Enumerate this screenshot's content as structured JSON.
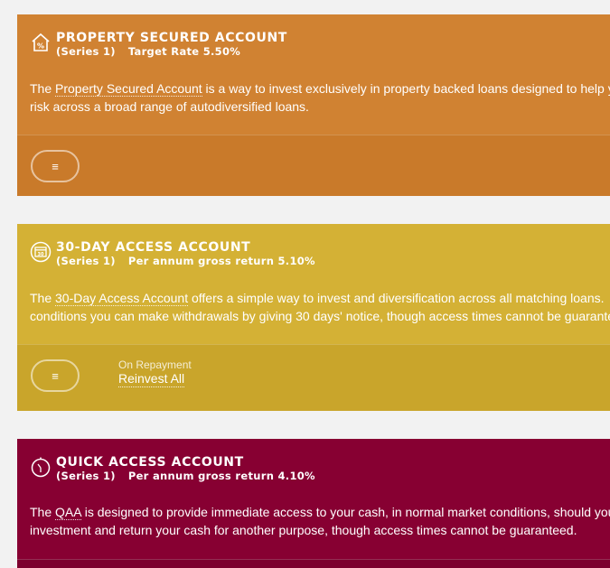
{
  "cards": [
    {
      "title": "PROPERTY SECURED ACCOUNT",
      "series": "(Series 1)",
      "rate_text": "Target Rate 5.50%",
      "desc_pre": "The ",
      "desc_link": "Property Secured Account",
      "desc_line1_post": " is a way to invest exclusively in property backed loans designed to help y",
      "desc_line2": "risk across a broad range of autodiversified loans.",
      "menu_glyph": "≡",
      "icon": "house-percent-icon",
      "color_top": "#d08232",
      "color_bottom": "#c97a2a"
    },
    {
      "title": "30-DAY ACCESS ACCOUNT",
      "series": "(Series 1)",
      "rate_text": "Per annum gross return 5.10%",
      "desc_pre": "The ",
      "desc_link": "30-Day Access Account",
      "desc_line1_post": " offers a simple way to invest and diversification across all matching loans.",
      "desc_line2": "conditions you can make withdrawals by giving 30 days' notice, though access times cannot be guarante",
      "menu_glyph": "≡",
      "repay_label": "On Repayment",
      "repay_value": "Reinvest All",
      "icon": "calendar-icon",
      "icon_text": "30",
      "color_top": "#d4b135",
      "color_bottom": "#c9a52b"
    },
    {
      "title": "QUICK ACCESS ACCOUNT",
      "series": "(Series 1)",
      "rate_text": "Per annum gross return 4.10%",
      "desc_pre": "The ",
      "desc_link": "QAA",
      "desc_line1_post": " is designed to provide immediate access to your cash, in normal market conditions, should you",
      "desc_line2": "investment and return your cash for another purpose, though access times cannot be guaranteed.",
      "icon": "stopwatch-icon",
      "color_top": "#870032",
      "color_bottom": "#7c002e"
    }
  ]
}
